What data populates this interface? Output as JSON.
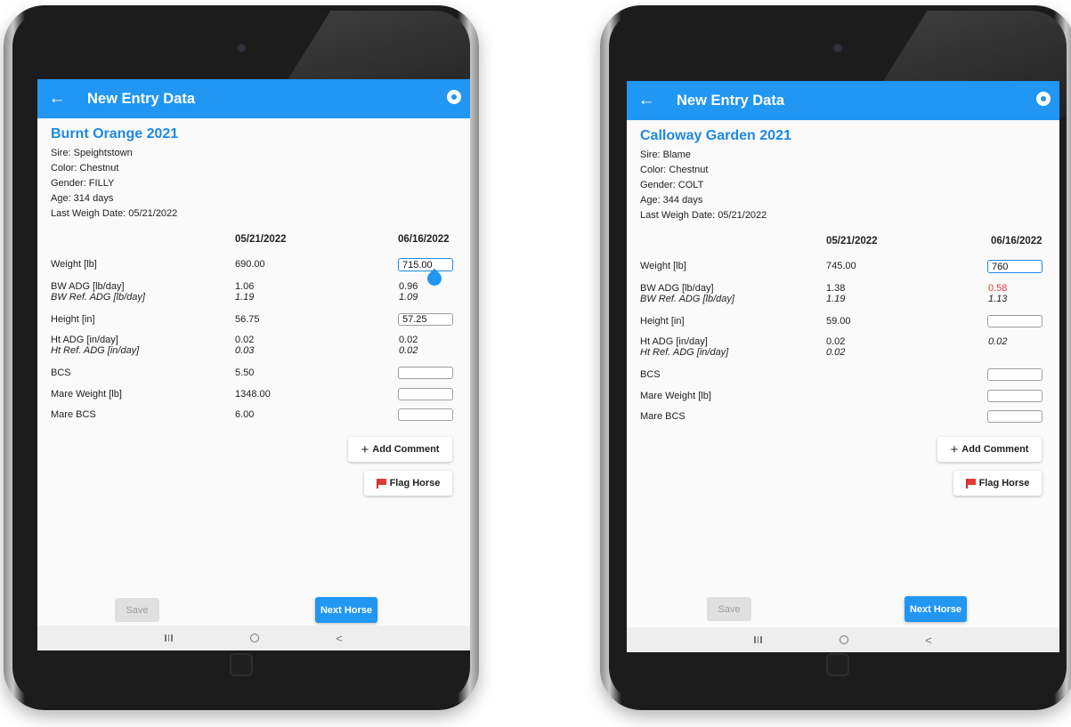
{
  "screens": [
    {
      "appbar": {
        "back_icon": "←",
        "title": "New Entry Data"
      },
      "horse": {
        "name": "Burnt Orange 2021",
        "sire": "Sire: Speightstown",
        "color": "Color: Chestnut",
        "gender": "Gender: FILLY",
        "age": "Age: 314 days",
        "last_weigh": "Last Weigh Date: 05/21/2022"
      },
      "dates": [
        "05/21/2022",
        "06/16/2022"
      ],
      "rows": {
        "weight": {
          "label": "Weight [lb]",
          "prev": "690.00",
          "input": "715.00"
        },
        "bw_adg": {
          "label": "BW ADG [lb/day]",
          "sub": "BW Ref. ADG [lb/day]",
          "prev": "1.06",
          "prev_sub": "1.19",
          "new": "0.96",
          "new_sub": "1.09"
        },
        "height": {
          "label": "Height [in]",
          "prev": "56.75",
          "input": "57.25"
        },
        "ht_adg": {
          "label": "Ht ADG [in/day]",
          "sub": "Ht Ref. ADG [in/day]",
          "prev": "0.02",
          "prev_sub": "0.03",
          "new": "0.02",
          "new_sub": "0.02"
        },
        "bcs": {
          "label": "BCS",
          "prev": "5.50",
          "input": ""
        },
        "mare_weight": {
          "label": "Mare Weight [lb]",
          "prev": "1348.00",
          "input": ""
        },
        "mare_bcs": {
          "label": "Mare BCS",
          "prev": "6.00",
          "input": ""
        }
      },
      "buttons": {
        "add_comment": "Add Comment",
        "add_icon": "+",
        "flag_horse": "Flag Horse",
        "save": "Save",
        "next": "Next Horse"
      }
    },
    {
      "appbar": {
        "back_icon": "←",
        "title": "New Entry Data"
      },
      "horse": {
        "name": "Calloway Garden 2021",
        "sire": "Sire: Blame",
        "color": "Color: Chestnut",
        "gender": "Gender: COLT",
        "age": "Age: 344 days",
        "last_weigh": "Last Weigh Date: 05/21/2022"
      },
      "dates": [
        "05/21/2022",
        "06/16/2022"
      ],
      "rows": {
        "weight": {
          "label": "Weight [lb]",
          "prev": "745.00",
          "input": "760"
        },
        "bw_adg": {
          "label": "BW ADG [lb/day]",
          "sub": "BW Ref. ADG [lb/day]",
          "prev": "1.38",
          "prev_sub": "1.19",
          "new": "0.58",
          "new_sub": "1.13"
        },
        "height": {
          "label": "Height [in]",
          "prev": "59.00",
          "input": ""
        },
        "ht_adg": {
          "label": "Ht ADG [in/day]",
          "sub": "Ht Ref. ADG [in/day]",
          "prev": "0.02",
          "prev_sub": "0.02",
          "new": "",
          "new_sub": "0.02"
        },
        "bcs": {
          "label": "BCS",
          "prev": "",
          "input": ""
        },
        "mare_weight": {
          "label": "Mare Weight [lb]",
          "prev": "",
          "input": ""
        },
        "mare_bcs": {
          "label": "Mare BCS",
          "prev": "",
          "input": ""
        }
      },
      "buttons": {
        "add_comment": "Add Comment",
        "add_icon": "+",
        "flag_horse": "Flag Horse",
        "save": "Save",
        "next": "Next Horse"
      }
    }
  ],
  "colors": {
    "primary": "#2196f3",
    "title_blue": "#1e88e5",
    "alert_red": "#e53935"
  },
  "icons": {
    "back": "arrow-left-icon",
    "settings": "aperture-settings-icon",
    "add": "plus-icon",
    "flag": "red-flag-icon"
  }
}
